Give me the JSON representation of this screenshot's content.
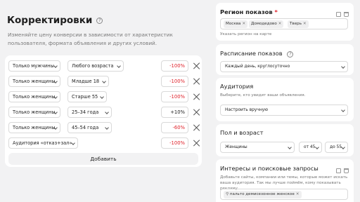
{
  "left": {
    "title": "Корректировки",
    "subtitle": "Изменяйте цену конверсии в зависимости от характеристик пользователя, формата объявления и других условий.",
    "rows": [
      {
        "a": "Только мужчины",
        "b": "Любого возраста",
        "pct": "-100%"
      },
      {
        "a": "Только женщины",
        "b": "Младше 18",
        "pct": "-100%"
      },
      {
        "a": "Только женщины",
        "b": "Старше 55",
        "pct": "-100%"
      },
      {
        "a": "Только женщины",
        "b": "25–34 года",
        "pct": "+10%"
      },
      {
        "a": "Только женщины",
        "b": "45–54 года",
        "pct": "-60%"
      },
      {
        "a": "Аудитория «отказ+зал»",
        "b": "",
        "pct": "-100%"
      }
    ],
    "add_label": "Добавить"
  },
  "right": {
    "region": {
      "title": "Регион показов",
      "required_mark": "*",
      "chips": [
        "Москва",
        "Домодедово",
        "Тверь"
      ],
      "hint": "Указать регион на карте"
    },
    "schedule": {
      "title": "Расписание показов",
      "value": "Каждый день, круглосуточно"
    },
    "audience": {
      "title": "Аудитория",
      "hint": "Выберите, кто увидит ваши объявления.",
      "value": "Настроить вручную"
    },
    "gender_age": {
      "title": "Пол и возраст",
      "gender": "Женщины",
      "from": "от 45",
      "to": "до 55"
    },
    "interests": {
      "title": "Интересы и поисковые запросы",
      "hint": "Добавьте сайты, компании или темы, которые может искать ваша аудитория. Так мы лучше поймём, кому показывать рекламу",
      "query": "пальто демисезонное женское"
    }
  },
  "colors": {
    "negative": "#e0242c",
    "background": "#f2f2f3",
    "card": "#ffffff"
  }
}
